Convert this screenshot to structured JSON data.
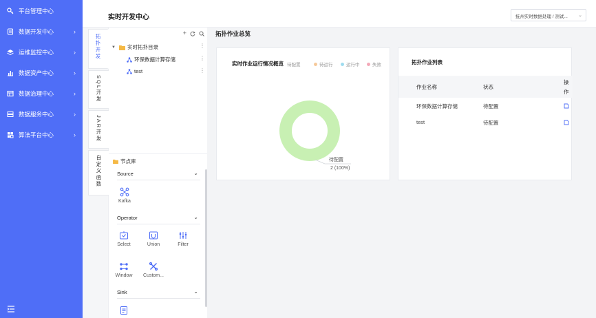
{
  "sidebar": {
    "items": [
      {
        "label": "平台管理中心",
        "icon": "key-icon",
        "expandable": false
      },
      {
        "label": "数据开发中心",
        "icon": "document-icon",
        "expandable": true
      },
      {
        "label": "运维监控中心",
        "icon": "layers-icon",
        "expandable": true
      },
      {
        "label": "数据资产中心",
        "icon": "bar-chart-icon",
        "expandable": true
      },
      {
        "label": "数据治理中心",
        "icon": "table-icon",
        "expandable": true
      },
      {
        "label": "数据服务中心",
        "icon": "server-icon",
        "expandable": true
      },
      {
        "label": "算法平台中心",
        "icon": "grid-icon",
        "expandable": true
      }
    ]
  },
  "header": {
    "title": "实时开发中心",
    "project_select": "抚州实时数据处理 / 测试..."
  },
  "vtabs": [
    {
      "label": "拓扑开发",
      "active": true
    },
    {
      "label": "SQL开发",
      "active": false
    },
    {
      "label": "JAR开发",
      "active": false
    },
    {
      "label": "自定义函数",
      "active": false
    }
  ],
  "tree": {
    "root": "实时拓扑目录",
    "children": [
      "环保数据计算存储",
      "test"
    ]
  },
  "library": {
    "title": "节点库",
    "sections": [
      {
        "title": "Source",
        "nodes": [
          "Kafka"
        ]
      },
      {
        "title": "Operator",
        "nodes": [
          "Select",
          "Union",
          "Filter",
          "Window",
          "Custom..."
        ]
      },
      {
        "title": "Sink",
        "nodes": [
          ""
        ]
      }
    ]
  },
  "main": {
    "title": "拓扑作业总览",
    "chart": {
      "title": "实时作业运行情况概览",
      "callout_label": "待配置",
      "callout_value": "2 (100%)"
    },
    "table": {
      "title": "拓扑作业列表",
      "columns": [
        "作业名称",
        "状态",
        "操作"
      ],
      "rows": [
        {
          "name": "环保数据计算存储",
          "status": "待配置"
        },
        {
          "name": "test",
          "status": "待配置"
        }
      ]
    }
  },
  "chart_data": {
    "type": "pie",
    "title": "实时作业运行情况概览",
    "categories": [
      "待配置",
      "待运行",
      "运行中",
      "失败"
    ],
    "values": [
      2,
      0,
      0,
      0
    ],
    "colors": [
      "#c8f0b3",
      "#f6c99a",
      "#9fdcef",
      "#f4a9b8"
    ],
    "legend": "top-right",
    "donut": true
  },
  "colors": {
    "sidebar": "#4f6ef7",
    "accent": "#4f6ef7",
    "folder": "#f5b945"
  }
}
